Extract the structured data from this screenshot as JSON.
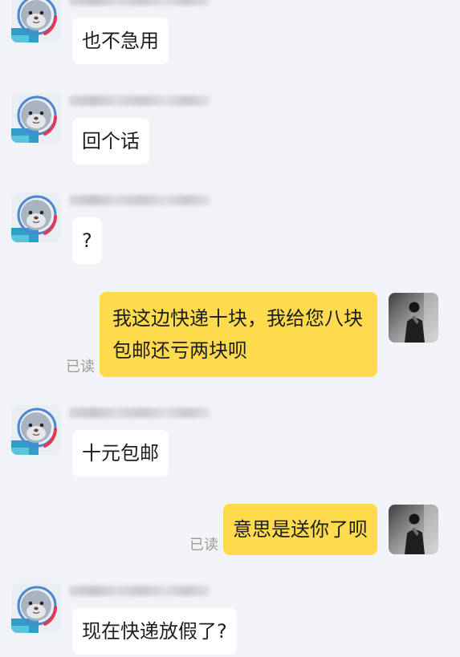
{
  "chat": {
    "messages": [
      {
        "text": "也不急用"
      },
      {
        "text": "回个话"
      },
      {
        "text": "?"
      },
      {
        "text": "我这边快递十块，我给您八块包邮还亏两块呗",
        "status": "已读"
      },
      {
        "text": "十元包邮"
      },
      {
        "text": "意思是送你了呗",
        "status": "已读"
      },
      {
        "text": "现在快递放假了?"
      }
    ]
  },
  "icons": {
    "contact_avatar": "seal-avatar-icon",
    "own_avatar": "user-photo-avatar-icon"
  },
  "colors": {
    "background": "#f2f3f7",
    "incoming_bubble": "#ffffff",
    "outgoing_bubble": "#ffdb4d",
    "message_text": "#1e1e1e",
    "read_status": "#9b9b9b"
  }
}
